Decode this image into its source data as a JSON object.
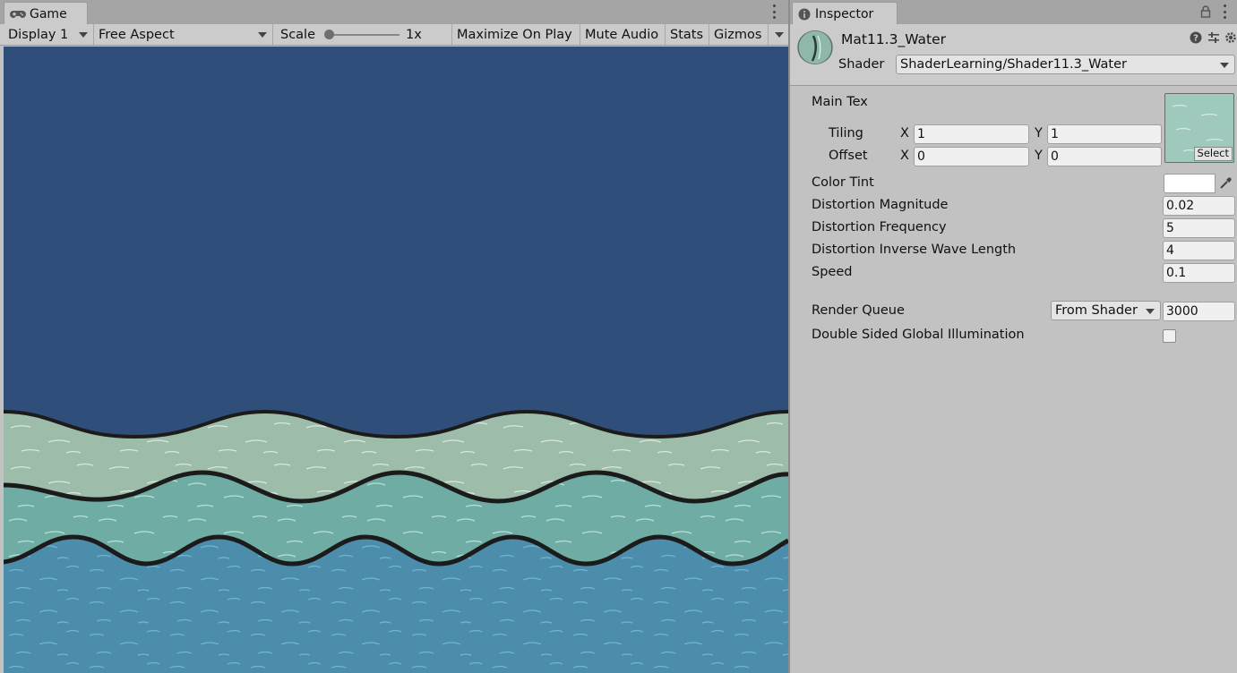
{
  "game": {
    "tab_label": "Game",
    "toolbar": {
      "display": "Display 1",
      "aspect": "Free Aspect",
      "scale_label": "Scale",
      "scale_value": "1x",
      "maximize_on_play": "Maximize On Play",
      "mute_audio": "Mute Audio",
      "stats": "Stats",
      "gizmos": "Gizmos"
    },
    "colors": {
      "sky": "#304e7a",
      "wave_back": "#9ebcaa",
      "wave_mid": "#6fada4",
      "wave_front": "#4d8dac",
      "outline": "#1b1b1b"
    }
  },
  "inspector": {
    "tab_label": "Inspector",
    "material_name": "Mat11.3_Water",
    "shader_label": "Shader",
    "shader_value": "ShaderLearning/Shader11.3_Water",
    "main_tex_label": "Main Tex",
    "tiling_label": "Tiling",
    "offset_label": "Offset",
    "x_label": "X",
    "y_label": "Y",
    "tiling_x": "1",
    "tiling_y": "1",
    "offset_x": "0",
    "offset_y": "0",
    "select_label": "Select",
    "color_tint_label": "Color Tint",
    "properties": [
      {
        "label": "Distortion Magnitude",
        "value": "0.02"
      },
      {
        "label": "Distortion Frequency",
        "value": "5"
      },
      {
        "label": "Distortion Inverse Wave Length",
        "value": "4"
      },
      {
        "label": "Speed",
        "value": "0.1"
      }
    ],
    "render_queue_label": "Render Queue",
    "render_queue_mode": "From Shader",
    "render_queue_value": "3000",
    "dsgi_label": "Double Sided Global Illumination"
  }
}
